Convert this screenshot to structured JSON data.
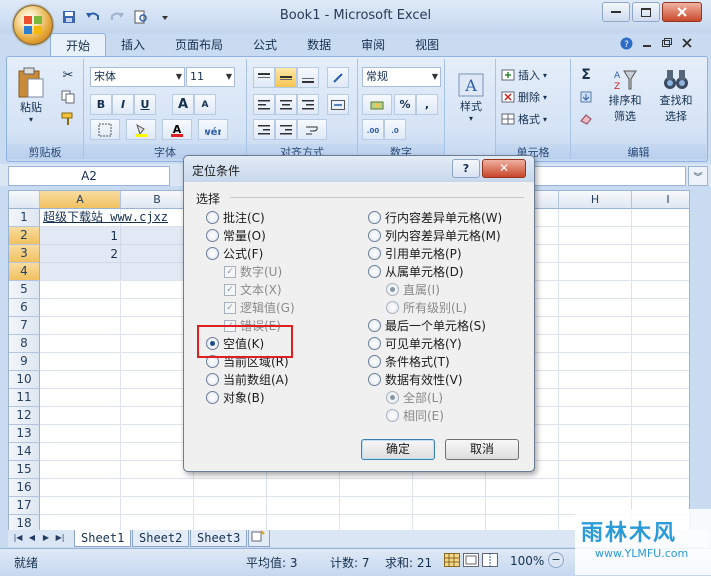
{
  "window": {
    "title": "Book1 - Microsoft Excel"
  },
  "tabs": [
    "开始",
    "插入",
    "页面布局",
    "公式",
    "数据",
    "审阅",
    "视图"
  ],
  "ribbon": {
    "clipboard": {
      "label": "剪贴板",
      "paste": "粘贴"
    },
    "font": {
      "label": "字体",
      "font_name": "宋体",
      "font_size": "11",
      "bold": "B",
      "italic": "I",
      "underline": "U",
      "grow": "A",
      "shrink": "A"
    },
    "alignment": {
      "label": "对齐方式"
    },
    "number": {
      "label": "数字",
      "format": "常规",
      "percent": "%",
      "comma": ","
    },
    "styles": {
      "label": "样式"
    },
    "cells": {
      "label": "单元格",
      "insert": "插入",
      "delete": "删除",
      "format": "格式"
    },
    "editing": {
      "label": "编辑",
      "sort_filter_1": "排序和",
      "sort_filter_2": "筛选",
      "find_select_1": "查找和",
      "find_select_2": "选择"
    }
  },
  "formula_bar": {
    "name_box": "A2"
  },
  "grid": {
    "columns": [
      "A",
      "B",
      "C",
      "D",
      "E",
      "F",
      "G",
      "H",
      "I"
    ],
    "rows": [
      "1",
      "2",
      "3",
      "4",
      "5",
      "6",
      "7",
      "8",
      "9",
      "10",
      "11",
      "12",
      "13",
      "14",
      "15",
      "16",
      "17",
      "18"
    ],
    "cells": {
      "A1": "超级下载站 www.cjxz",
      "A2": "1",
      "A3": "2"
    }
  },
  "sheet_tabs": [
    "Sheet1",
    "Sheet2",
    "Sheet3"
  ],
  "status_bar": {
    "ready": "就绪",
    "average": "平均值: 3",
    "count": "计数: 7",
    "sum": "求和: 21",
    "zoom": "100%"
  },
  "dialog": {
    "title": "定位条件",
    "help": "?",
    "group_label": "选择",
    "options_left": [
      {
        "label": "批注(C)",
        "type": "radio",
        "checked": false,
        "disabled": false
      },
      {
        "label": "常量(O)",
        "type": "radio",
        "checked": false,
        "disabled": false
      },
      {
        "label": "公式(F)",
        "type": "radio",
        "checked": false,
        "disabled": false
      },
      {
        "label": "数字(U)",
        "type": "check",
        "checked": true,
        "disabled": true
      },
      {
        "label": "文本(X)",
        "type": "check",
        "checked": true,
        "disabled": true
      },
      {
        "label": "逻辑值(G)",
        "type": "check",
        "checked": true,
        "disabled": true
      },
      {
        "label": "错误(E)",
        "type": "check",
        "checked": true,
        "disabled": true
      },
      {
        "label": "空值(K)",
        "type": "radio",
        "checked": true,
        "disabled": false
      },
      {
        "label": "当前区域(R)",
        "type": "radio",
        "checked": false,
        "disabled": false
      },
      {
        "label": "当前数组(A)",
        "type": "radio",
        "checked": false,
        "disabled": false
      },
      {
        "label": "对象(B)",
        "type": "radio",
        "checked": false,
        "disabled": false
      }
    ],
    "options_right": [
      {
        "label": "行内容差异单元格(W)",
        "type": "radio",
        "checked": false,
        "disabled": false
      },
      {
        "label": "列内容差异单元格(M)",
        "type": "radio",
        "checked": false,
        "disabled": false
      },
      {
        "label": "引用单元格(P)",
        "type": "radio",
        "checked": false,
        "disabled": false
      },
      {
        "label": "从属单元格(D)",
        "type": "radio",
        "checked": false,
        "disabled": false
      },
      {
        "label": "直属(I)",
        "type": "radio",
        "checked": true,
        "disabled": true
      },
      {
        "label": "所有级别(L)",
        "type": "radio",
        "checked": false,
        "disabled": true
      },
      {
        "label": "最后一个单元格(S)",
        "type": "radio",
        "checked": false,
        "disabled": false
      },
      {
        "label": "可见单元格(Y)",
        "type": "radio",
        "checked": false,
        "disabled": false
      },
      {
        "label": "条件格式(T)",
        "type": "radio",
        "checked": false,
        "disabled": false
      },
      {
        "label": "数据有效性(V)",
        "type": "radio",
        "checked": false,
        "disabled": false
      },
      {
        "label": "全部(L)",
        "type": "radio",
        "checked": true,
        "disabled": true
      },
      {
        "label": "相同(E)",
        "type": "radio",
        "checked": false,
        "disabled": true
      }
    ],
    "ok": "确定",
    "cancel": "取消"
  },
  "watermark": {
    "name": "雨林木风",
    "url": "www.YLMFU.com"
  },
  "colors": {
    "accent_red": "#e02020",
    "ribbon_bg": "#d5e3f5",
    "selected_header": "#f1c15f"
  }
}
